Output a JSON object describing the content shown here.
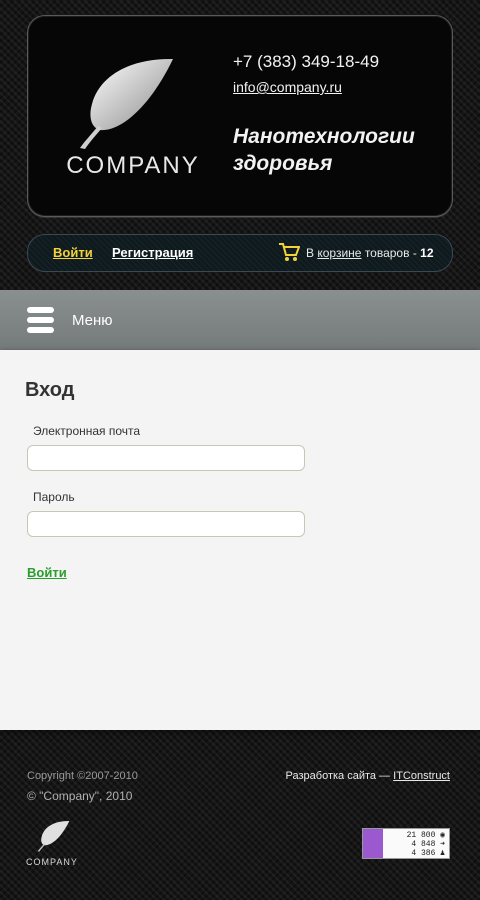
{
  "header": {
    "company_name": "COMPANY",
    "phone": "+7 (383) 349-18-49",
    "email": "info@company.ru",
    "slogan_line1": "Нанотехнологии",
    "slogan_line2": "здоровья"
  },
  "userbar": {
    "login": "Войти",
    "register": "Регистрация",
    "cart_prefix": "В",
    "cart_link": "корзине",
    "cart_suffix": "товаров -",
    "cart_count": "12"
  },
  "menu": {
    "label": "Меню"
  },
  "main": {
    "title": "Вход",
    "email_label": "Электронная почта",
    "email_value": "",
    "password_label": "Пароль",
    "password_value": "",
    "submit": "Войти"
  },
  "footer": {
    "copyright_line1": "Copyright ©2007-2010",
    "copyright_line2": "© \"Company\", 2010",
    "dev_prefix": "Разработка сайта —",
    "dev_link": "ITConstruct",
    "logo_text": "COMPANY",
    "counter": {
      "row1": "21 800 ◉",
      "row2": "4 848 ➜",
      "row3": "4 386 ♟"
    }
  },
  "colors": {
    "accent_login": "#f3d23a",
    "submit_green": "#2a9d2a",
    "menu_bg": "#7f8484"
  }
}
